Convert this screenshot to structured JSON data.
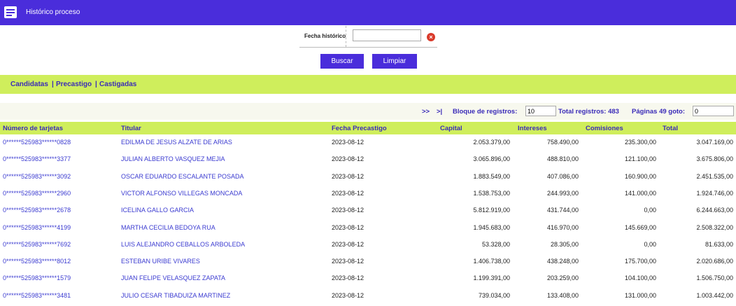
{
  "header": {
    "title": "Histórico proceso",
    "icon": "list-window-icon"
  },
  "filter": {
    "label": "Fecha histórico",
    "value": "",
    "clear_icon": "clear-x-icon"
  },
  "buttons": {
    "search": "Buscar",
    "clear": "Limpiar"
  },
  "nav": {
    "candidatas": "Candidatas",
    "sep1": "|",
    "precastigo": "Precastigo",
    "sep2": "|",
    "castigadas": "Castigadas"
  },
  "pager": {
    "next": ">>",
    "last": ">|",
    "block_label": "Bloque de registros:",
    "block_value": "10",
    "total_label": "Total registros: 483",
    "pages_label": "Páginas 49 goto:",
    "goto_value": "0"
  },
  "table": {
    "headers": [
      "Número de tarjetas",
      "Titular",
      "Fecha Precastigo",
      "Capital",
      "Intereses",
      "Comisiones",
      "Total"
    ],
    "rows": [
      [
        "0******525983******0828",
        "EDILMA DE JESUS ALZATE DE ARIAS",
        "2023-08-12",
        "2.053.379,00",
        "758.490,00",
        "235.300,00",
        "3.047.169,00"
      ],
      [
        "0******525983******3377",
        "JULIAN ALBERTO VASQUEZ MEJIA",
        "2023-08-12",
        "3.065.896,00",
        "488.810,00",
        "121.100,00",
        "3.675.806,00"
      ],
      [
        "0******525983******3092",
        "OSCAR EDUARDO ESCALANTE POSADA",
        "2023-08-12",
        "1.883.549,00",
        "407.086,00",
        "160.900,00",
        "2.451.535,00"
      ],
      [
        "0******525983******2960",
        "VICTOR ALFONSO VILLEGAS MONCADA",
        "2023-08-12",
        "1.538.753,00",
        "244.993,00",
        "141.000,00",
        "1.924.746,00"
      ],
      [
        "0******525983******2678",
        "ICELINA GALLO GARCIA",
        "2023-08-12",
        "5.812.919,00",
        "431.744,00",
        "0,00",
        "6.244.663,00"
      ],
      [
        "0******525983******4199",
        "MARTHA CECILIA BEDOYA RUA",
        "2023-08-12",
        "1.945.683,00",
        "416.970,00",
        "145.669,00",
        "2.508.322,00"
      ],
      [
        "0******525983******7692",
        "LUIS ALEJANDRO CEBALLOS ARBOLEDA",
        "2023-08-12",
        "53.328,00",
        "28.305,00",
        "0,00",
        "81.633,00"
      ],
      [
        "0******525983******8012",
        "ESTEBAN URIBE VIVARES",
        "2023-08-12",
        "1.406.738,00",
        "438.248,00",
        "175.700,00",
        "2.020.686,00"
      ],
      [
        "0******525983******1579",
        "JUAN FELIPE VELASQUEZ ZAPATA",
        "2023-08-12",
        "1.199.391,00",
        "203.259,00",
        "104.100,00",
        "1.506.750,00"
      ],
      [
        "0******525983******3481",
        "JULIO CESAR TIBADUIZA MARTINEZ",
        "2023-08-12",
        "739.034,00",
        "133.408,00",
        "131.000,00",
        "1.003.442,00"
      ]
    ]
  },
  "colors": {
    "header_bg": "#4a2ddb",
    "band_bg": "#cfee5c",
    "link": "#3a3ad0",
    "clear_icon": "#d93a2b"
  }
}
